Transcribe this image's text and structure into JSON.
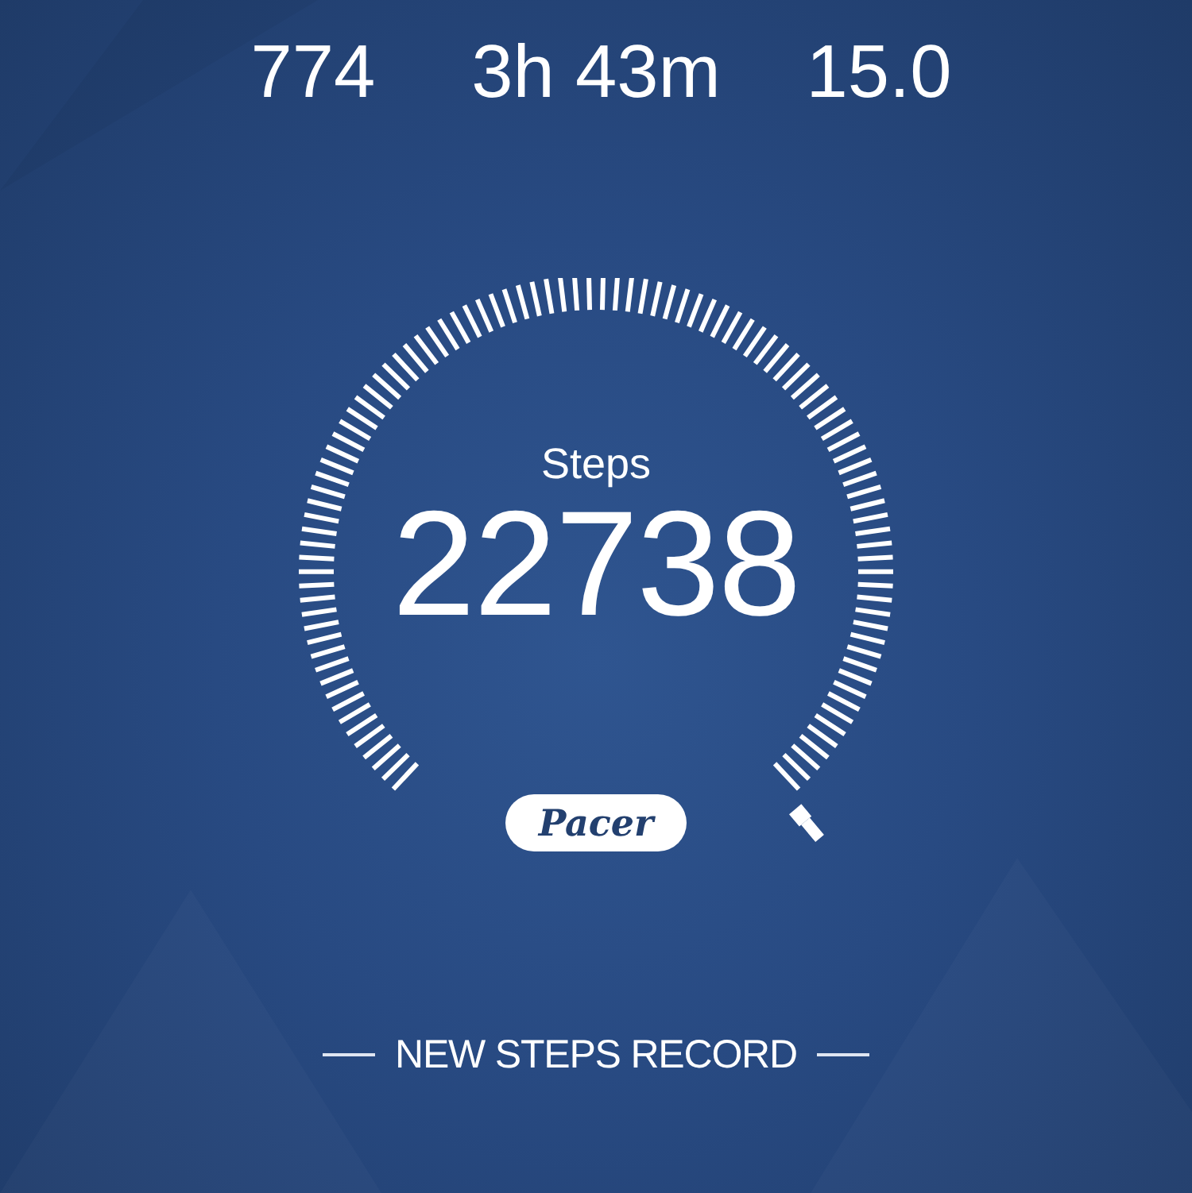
{
  "stats": [
    {
      "value": "774"
    },
    {
      "value": "3h 43m"
    },
    {
      "value": "15.0"
    }
  ],
  "gauge": {
    "label": "Steps",
    "value": "22738"
  },
  "brand": "Pacer",
  "record": "NEW STEPS RECORD"
}
